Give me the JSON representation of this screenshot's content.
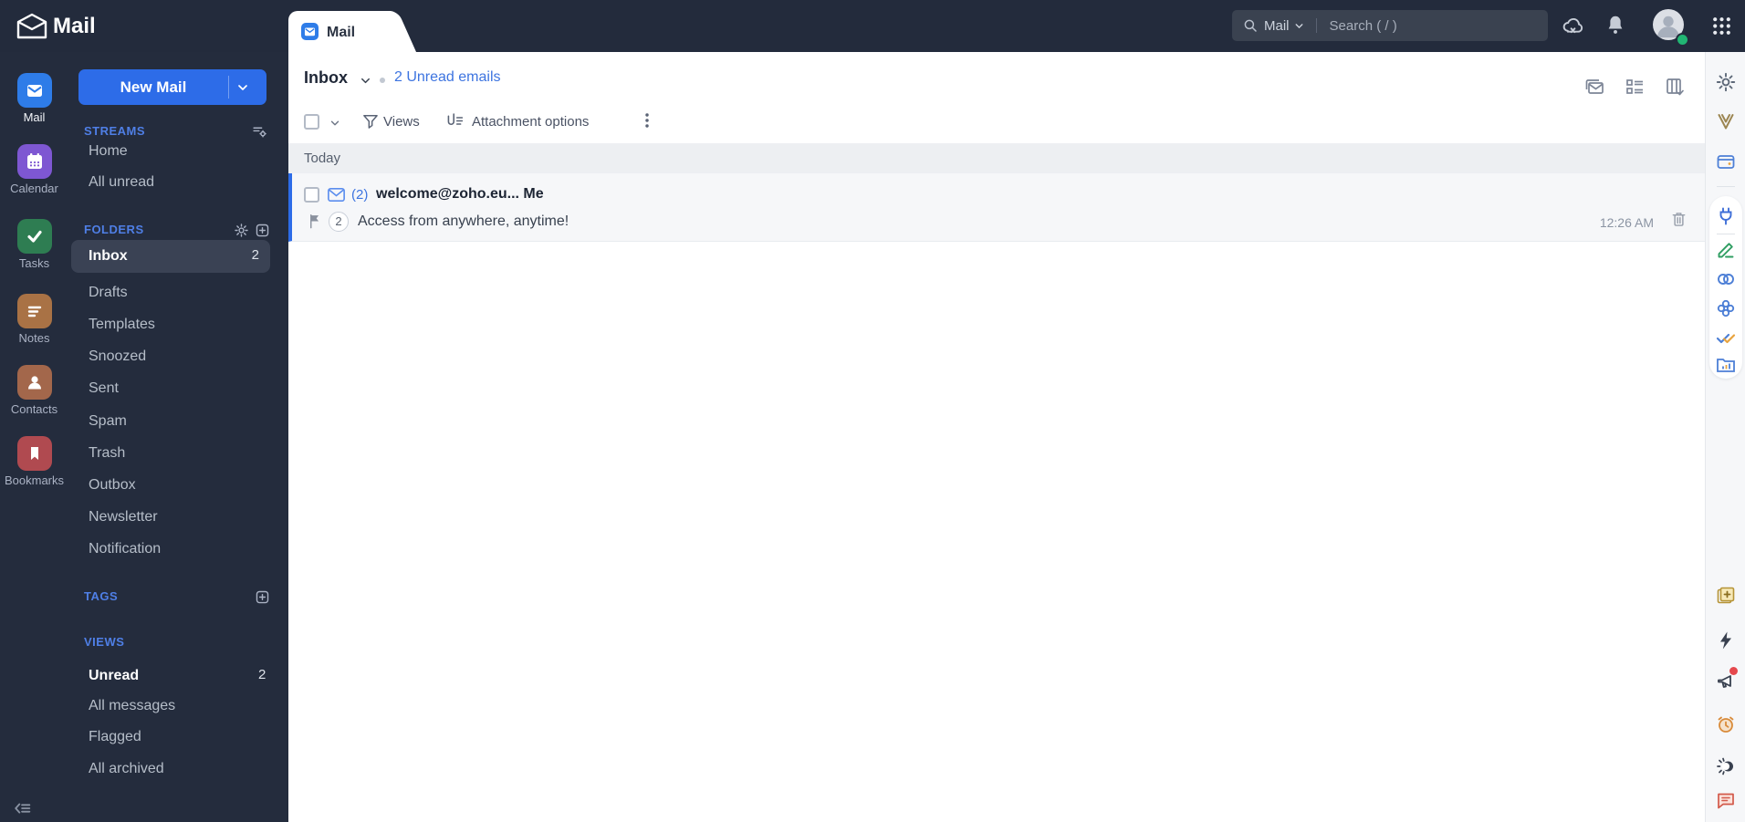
{
  "colors": {
    "accent_blue": "#2d6ce8",
    "topbar_bg": "#232b3c",
    "sidebar_bg": "#242c3d",
    "selected_item_bg": "#3a4254",
    "link_blue": "#3d74e0",
    "unread_row_bg": "#f6f7f9",
    "group_header_bg": "#edeff2",
    "presence_green": "#21b573",
    "alert_red": "#e5484d"
  },
  "topbar": {
    "app_title": "Mail",
    "search": {
      "scope_label": "Mail",
      "placeholder": "Search ( / )"
    }
  },
  "rail": {
    "items": [
      {
        "label": "Mail",
        "active": true,
        "color": "#2e7ce8"
      },
      {
        "label": "Calendar",
        "color": "#7e57d2"
      },
      {
        "label": "Tasks",
        "color": "#2e7d52"
      },
      {
        "label": "Notes",
        "color": "#a97245"
      },
      {
        "label": "Contacts",
        "color": "#a3674b"
      },
      {
        "label": "Bookmarks",
        "color": "#b04a50"
      }
    ]
  },
  "sidebar": {
    "new_mail_label": "New Mail",
    "streams": {
      "title": "STREAMS",
      "items": [
        {
          "label": "Home"
        },
        {
          "label": "All unread"
        }
      ]
    },
    "folders": {
      "title": "FOLDERS",
      "items": [
        {
          "label": "Inbox",
          "badge": "2",
          "selected": true
        },
        {
          "label": "Drafts"
        },
        {
          "label": "Templates"
        },
        {
          "label": "Snoozed"
        },
        {
          "label": "Sent"
        },
        {
          "label": "Spam"
        },
        {
          "label": "Trash"
        },
        {
          "label": "Outbox"
        },
        {
          "label": "Newsletter"
        },
        {
          "label": "Notification"
        }
      ]
    },
    "tags": {
      "title": "TAGS"
    },
    "views": {
      "title": "VIEWS",
      "items": [
        {
          "label": "Unread",
          "badge": "2",
          "selected": true
        },
        {
          "label": "All messages"
        },
        {
          "label": "Flagged"
        },
        {
          "label": "All archived"
        }
      ]
    }
  },
  "main": {
    "tab_label": "Mail",
    "header": {
      "folder_name": "Inbox",
      "unread_link": "2 Unread emails"
    },
    "toolbar": {
      "views_label": "Views",
      "attachment_label": "Attachment options"
    },
    "list": {
      "group_header": "Today",
      "emails": [
        {
          "count_prefix": "(2)",
          "sender": "welcome@zoho.eu... Me",
          "thread_count": "2",
          "snippet": "Access from anywhere, anytime!",
          "time": "12:26 AM"
        }
      ]
    }
  },
  "right_strip": {
    "icons": [
      "settings-gear",
      "vault",
      "wallet",
      "plug-extension",
      "sign",
      "links",
      "clover",
      "double-check",
      "reports-folder",
      "sticky-note-add",
      "bolt",
      "announcement",
      "alarm",
      "theme-toggle",
      "feedback-chat"
    ]
  }
}
